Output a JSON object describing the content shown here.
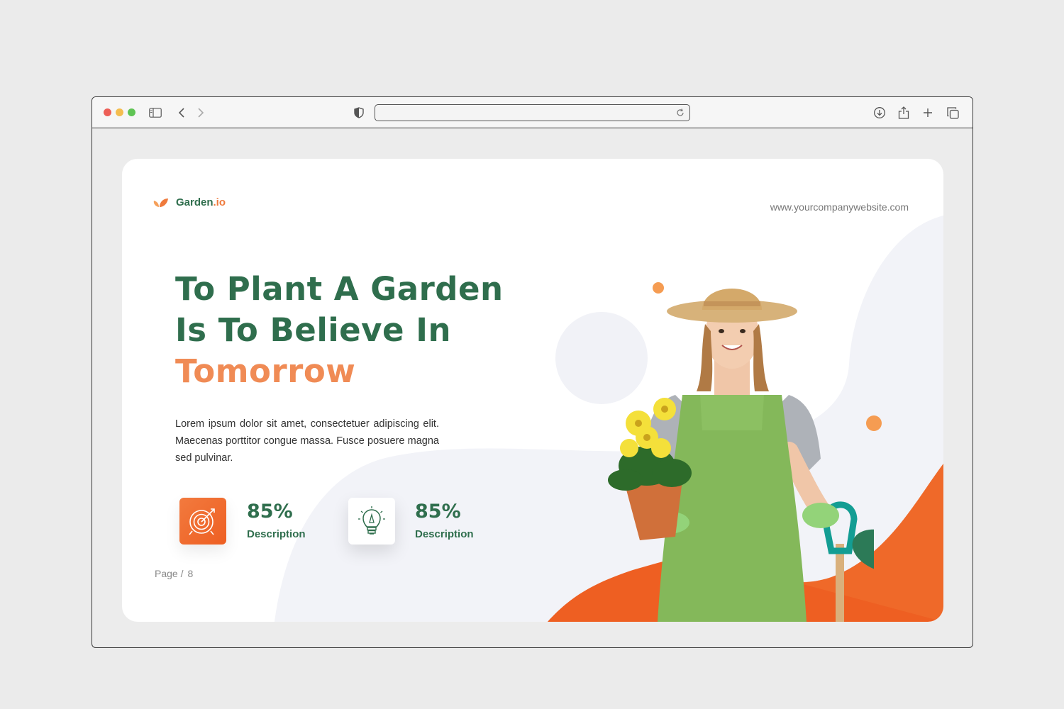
{
  "browser": {
    "address_value": "",
    "icons": [
      "sidebar-icon",
      "back-icon",
      "forward-icon",
      "shield-icon",
      "reload-icon",
      "download-icon",
      "share-icon",
      "new-tab-icon",
      "tabs-icon"
    ]
  },
  "slide": {
    "brand": {
      "name": "Garden",
      "suffix": ".io"
    },
    "website": "www.yourcompanywebsite.com",
    "headline": {
      "line1": "To Plant A Garden",
      "line2": "Is To Believe In",
      "line3": "Tomorrow"
    },
    "body": "Lorem ipsum dolor sit amet, consectetuer adipiscing elit. Maecenas porttitor congue massa. Fusce posuere magna sed pulvinar.",
    "stats": [
      {
        "value": "85%",
        "label": "Description",
        "icon": "target-icon"
      },
      {
        "value": "85%",
        "label": "Description",
        "icon": "lightbulb-icon"
      }
    ],
    "page": {
      "label": "Page /",
      "number": "8"
    }
  },
  "colors": {
    "brand_green": "#2f6e4d",
    "accent_orange": "#f08b55",
    "deep_orange": "#ee5f22",
    "blob_gray": "#f2f3f8"
  }
}
